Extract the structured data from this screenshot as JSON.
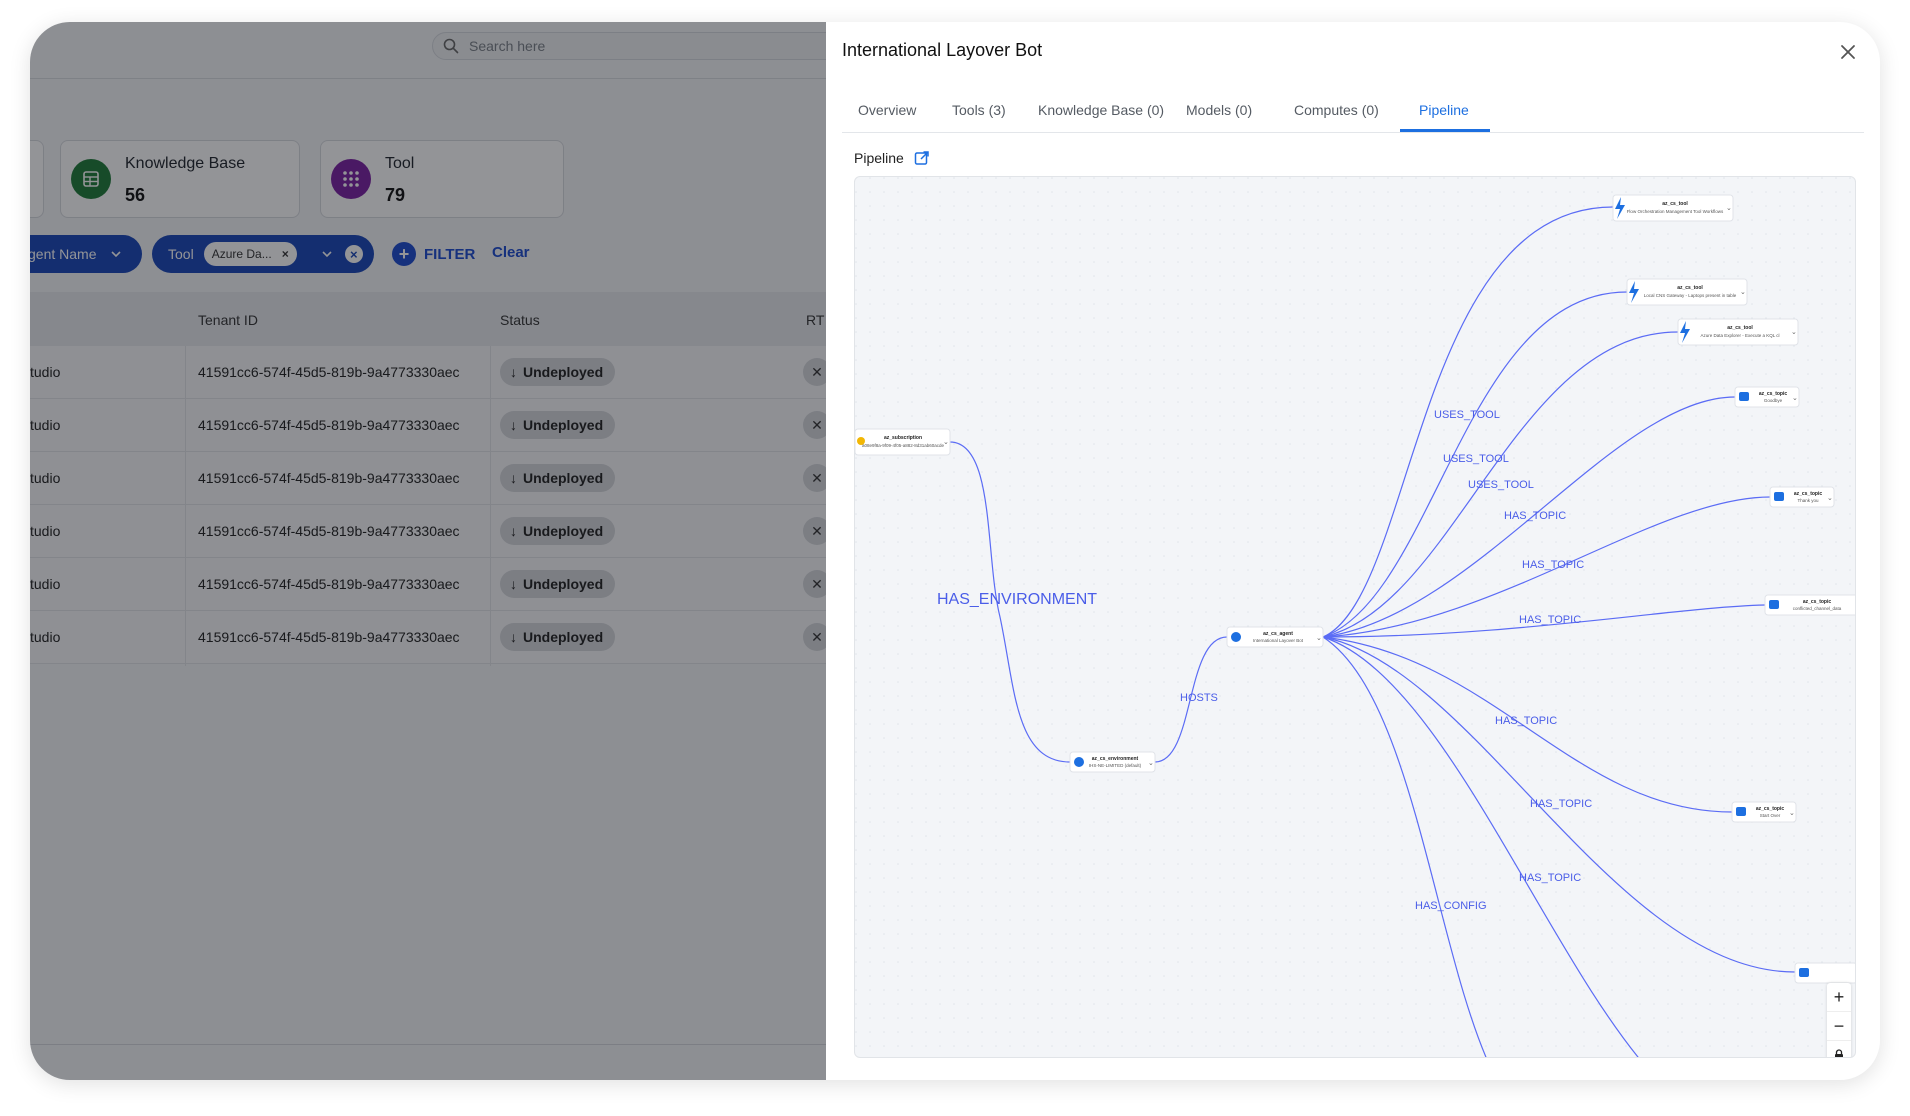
{
  "search": {
    "placeholder": "Search here"
  },
  "cards": [
    {
      "label": "Knowledge Base",
      "value": "56"
    },
    {
      "label": "Tool",
      "value": "79"
    }
  ],
  "filters": {
    "agent_chip": "gent Name",
    "tool_chip": "Tool",
    "tool_value": "Azure Da...",
    "filter_label": "FILTER",
    "clear_label": "Clear"
  },
  "table": {
    "headers": [
      "Tenant ID",
      "Status",
      "RT"
    ],
    "rows": [
      {
        "c1": "tudio",
        "tenant": "41591cc6-574f-45d5-819b-9a4773330aec",
        "status": "Undeployed"
      },
      {
        "c1": "tudio",
        "tenant": "41591cc6-574f-45d5-819b-9a4773330aec",
        "status": "Undeployed"
      },
      {
        "c1": "tudio",
        "tenant": "41591cc6-574f-45d5-819b-9a4773330aec",
        "status": "Undeployed"
      },
      {
        "c1": "tudio",
        "tenant": "41591cc6-574f-45d5-819b-9a4773330aec",
        "status": "Undeployed"
      },
      {
        "c1": "tudio",
        "tenant": "41591cc6-574f-45d5-819b-9a4773330aec",
        "status": "Undeployed"
      },
      {
        "c1": "tudio",
        "tenant": "41591cc6-574f-45d5-819b-9a4773330aec",
        "status": "Undeployed"
      }
    ]
  },
  "panel": {
    "title": "International Layover Bot",
    "tabs": [
      "Overview",
      "Tools (3)",
      "Knowledge Base (0)",
      "Models (0)",
      "Computes (0)",
      "Pipeline"
    ],
    "active_tab": "Pipeline",
    "pipeline_label": "Pipeline"
  },
  "graph": {
    "edge_labels": {
      "has_environment": "HAS_ENVIRONMENT",
      "hosts": "HOSTS",
      "uses_tool": "USES_TOOL",
      "has_topic": "HAS_TOPIC",
      "has_config": "HAS_CONFIG"
    },
    "nodes": {
      "subscription": {
        "type": "az_subscription",
        "name": "a08e9f8a-9f09-4f05-a882-8d31ab60acde"
      },
      "environment": {
        "type": "az_cs_environment",
        "name": "IHS-NE-LIMITED (default)"
      },
      "agent": {
        "type": "az_cs_agent",
        "name": "International Layover Bot"
      },
      "tool1": {
        "type": "az_cs_tool",
        "name": "Flow Orchestration Management Tool Workflows"
      },
      "tool2": {
        "type": "az_cs_tool",
        "name": "Local CNS Gateway - Laptops present in table"
      },
      "tool3": {
        "type": "az_cs_tool",
        "name": "Azure Data Explorer - Execute a KQL cl"
      },
      "topic1": {
        "type": "az_cs_topic",
        "name": "Goodbye"
      },
      "topic2": {
        "type": "az_cs_topic",
        "name": "Thank you"
      },
      "topic3": {
        "type": "az_cs_topic",
        "name": "conflicted_channel_data"
      },
      "topic4": {
        "type": "az_cs_topic",
        "name": "Start Over"
      }
    }
  },
  "colors": {
    "accent": "#1d6fe0",
    "edge": "#5b6cf5",
    "chip": "#1845b8"
  }
}
